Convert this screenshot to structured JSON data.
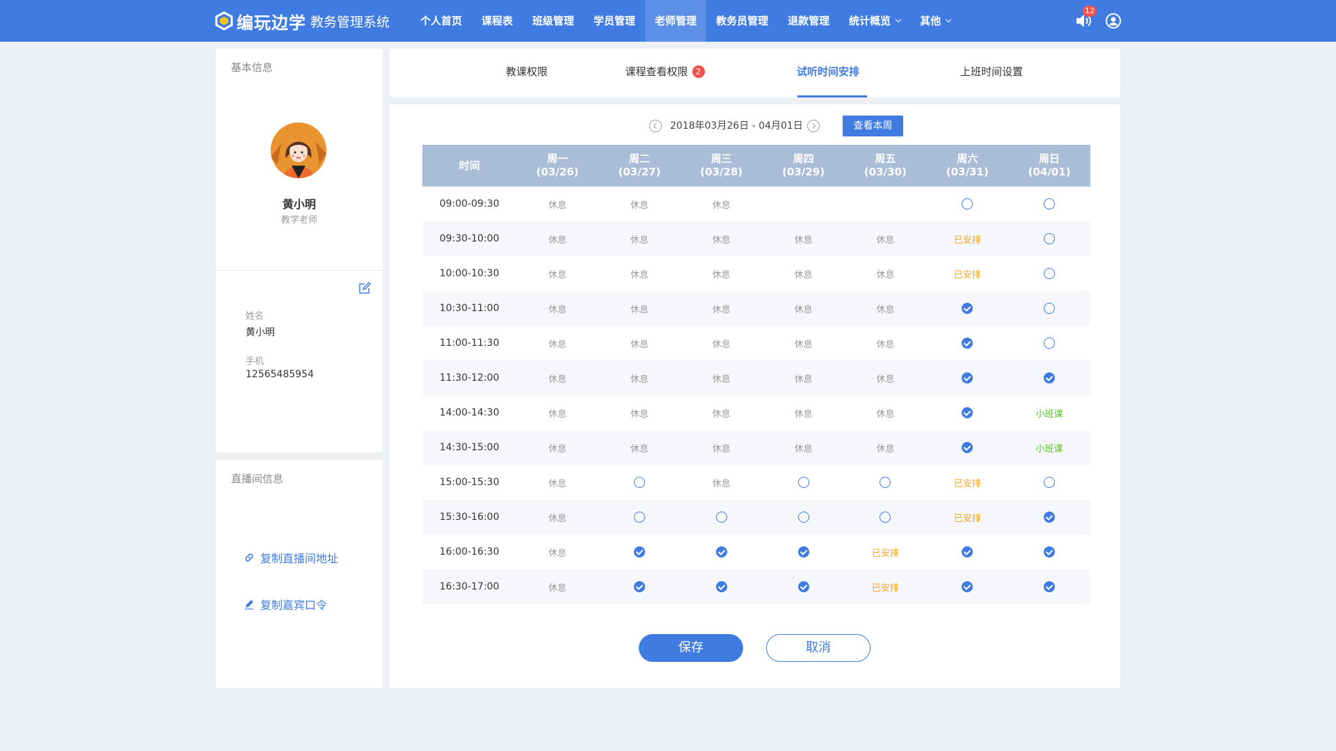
{
  "app": {
    "brand": "编玩边学",
    "system_name": "教务管理系统",
    "notification_count": "12"
  },
  "nav": {
    "items": [
      {
        "label": "个人首页"
      },
      {
        "label": "课程表"
      },
      {
        "label": "班级管理"
      },
      {
        "label": "学员管理"
      },
      {
        "label": "老师管理",
        "active": true
      },
      {
        "label": "教务员管理"
      },
      {
        "label": "退款管理"
      },
      {
        "label": "统计概览",
        "dropdown": true
      },
      {
        "label": "其他",
        "dropdown": true
      }
    ]
  },
  "basic_info": {
    "title": "基本信息",
    "name": "黄小明",
    "role": "教学老师",
    "fields": {
      "name_label": "姓名",
      "name_value": "黄小明",
      "phone_label": "手机",
      "phone_value": "12565485954"
    }
  },
  "live_info": {
    "title": "直播间信息",
    "copy_url_label": "复制直播间地址",
    "copy_code_label": "复制嘉宾口令"
  },
  "tabs": [
    {
      "label": "教课权限"
    },
    {
      "label": "课程查看权限",
      "badge": "2"
    },
    {
      "label": "试听时间安排",
      "active": true
    },
    {
      "label": "上班时间设置"
    }
  ],
  "schedule": {
    "date_range": "2018年03月26日 - 04月01日",
    "this_week_label": "查看本周",
    "time_header": "时间",
    "days": [
      {
        "day": "周一",
        "date": "(03/26)"
      },
      {
        "day": "周二",
        "date": "(03/27)"
      },
      {
        "day": "周三",
        "date": "(03/28)"
      },
      {
        "day": "周四",
        "date": "(03/29)"
      },
      {
        "day": "周五",
        "date": "(03/30)"
      },
      {
        "day": "周六",
        "date": "(03/31)"
      },
      {
        "day": "周日",
        "date": "(04/01)"
      }
    ],
    "legend": {
      "rest": "休息",
      "arranged": "已安排",
      "small_class": "小班课"
    },
    "rows": [
      {
        "time": "09:00-09:30",
        "cells": [
          "rest",
          "rest",
          "rest",
          "empty",
          "empty",
          "open",
          "open"
        ]
      },
      {
        "time": "09:30-10:00",
        "cells": [
          "rest",
          "rest",
          "rest",
          "rest",
          "rest",
          "arranged",
          "open"
        ]
      },
      {
        "time": "10:00-10:30",
        "cells": [
          "rest",
          "rest",
          "rest",
          "rest",
          "rest",
          "arranged",
          "open"
        ]
      },
      {
        "time": "10:30-11:00",
        "cells": [
          "rest",
          "rest",
          "rest",
          "rest",
          "rest",
          "checked",
          "open"
        ]
      },
      {
        "time": "11:00-11:30",
        "cells": [
          "rest",
          "rest",
          "rest",
          "rest",
          "rest",
          "checked",
          "open"
        ]
      },
      {
        "time": "11:30-12:00",
        "cells": [
          "rest",
          "rest",
          "rest",
          "rest",
          "rest",
          "checked",
          "checked"
        ]
      },
      {
        "time": "14:00-14:30",
        "cells": [
          "rest",
          "rest",
          "rest",
          "rest",
          "rest",
          "checked",
          "small_class"
        ]
      },
      {
        "time": "14:30-15:00",
        "cells": [
          "rest",
          "rest",
          "rest",
          "rest",
          "rest",
          "checked",
          "small_class"
        ]
      },
      {
        "time": "15:00-15:30",
        "cells": [
          "rest",
          "open",
          "rest",
          "open",
          "open",
          "arranged",
          "open"
        ]
      },
      {
        "time": "15:30-16:00",
        "cells": [
          "rest",
          "open",
          "open",
          "open",
          "open",
          "arranged",
          "checked"
        ]
      },
      {
        "time": "16:00-16:30",
        "cells": [
          "rest",
          "checked",
          "checked",
          "checked",
          "arranged",
          "checked",
          "checked"
        ]
      },
      {
        "time": "16:30-17:00",
        "cells": [
          "rest",
          "checked",
          "checked",
          "checked",
          "arranged",
          "checked",
          "checked"
        ]
      }
    ]
  },
  "actions": {
    "save_label": "保存",
    "cancel_label": "取消"
  },
  "colors": {
    "primary": "#3f7be0",
    "header_bg": "#a9bed6",
    "arranged": "#f5a623",
    "small_class": "#52c41a",
    "badge": "#f5504a"
  }
}
